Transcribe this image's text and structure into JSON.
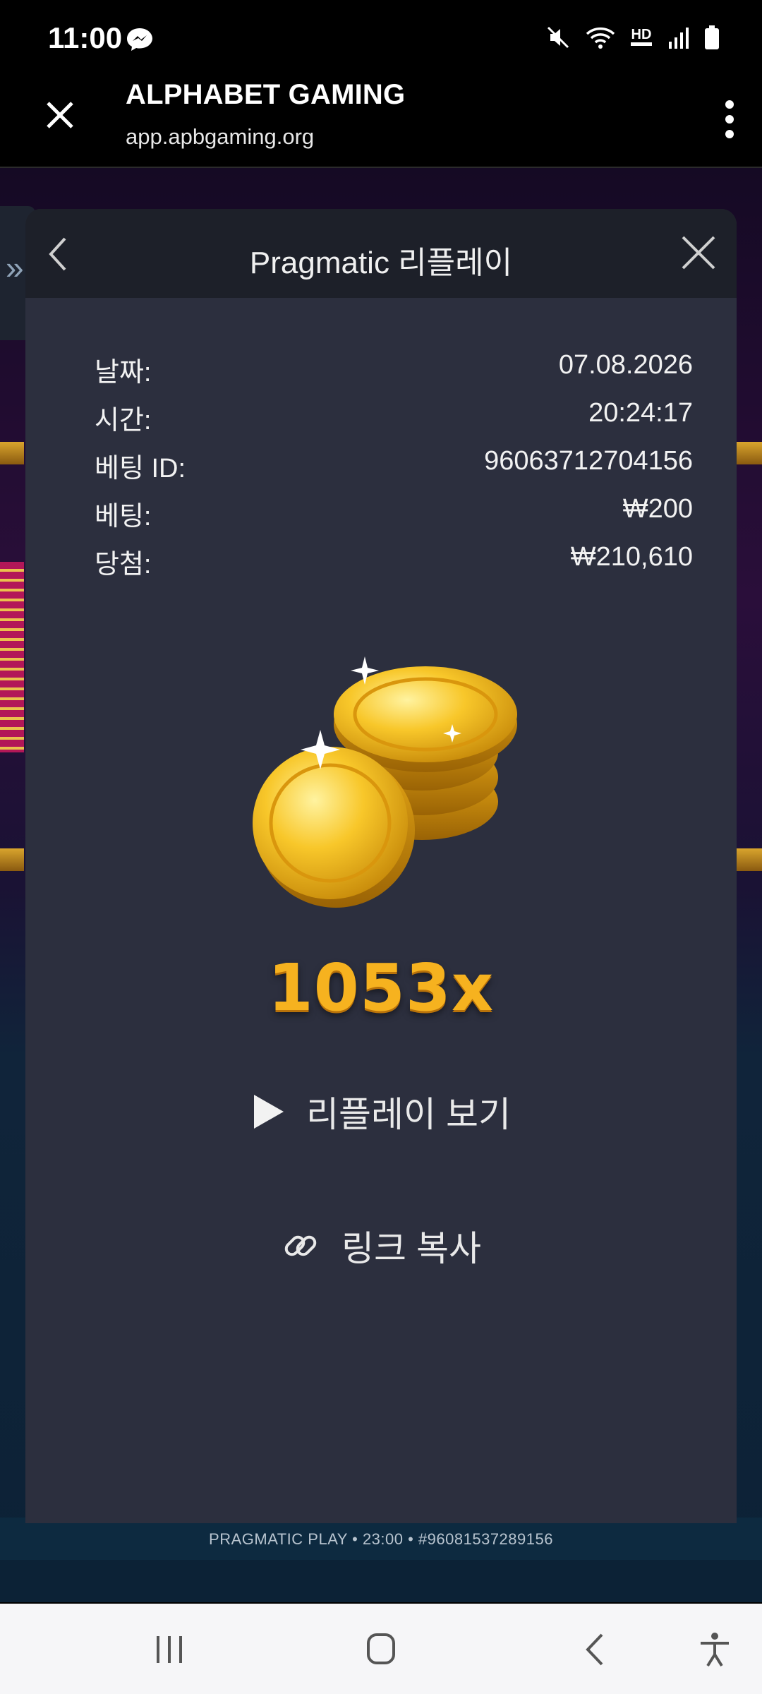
{
  "status_bar": {
    "time": "11:00",
    "network_label": "HD"
  },
  "browser": {
    "title": "ALPHABET GAMING",
    "url": "app.apbgaming.org"
  },
  "modal": {
    "title": "Pragmatic 리플레이",
    "info": [
      {
        "label": "날짜:",
        "value": "07.08.2026"
      },
      {
        "label": "시간:",
        "value": "20:24:17"
      },
      {
        "label": "베팅 ID:",
        "value": "96063712704156"
      },
      {
        "label": "베팅:",
        "value": "₩200"
      },
      {
        "label": "당첨:",
        "value": "₩210,610"
      }
    ],
    "multiplier": "1053x",
    "replay_button": "리플레이 보기",
    "copy_link_button": "링크 복사"
  },
  "background": {
    "caption": "PRAGMATIC PLAY • 23:00 • #96081537289156"
  },
  "colors": {
    "modal_bg": "#2c2f3e",
    "modal_header": "#1d2029",
    "multiplier_gold": "#f6b21f"
  }
}
